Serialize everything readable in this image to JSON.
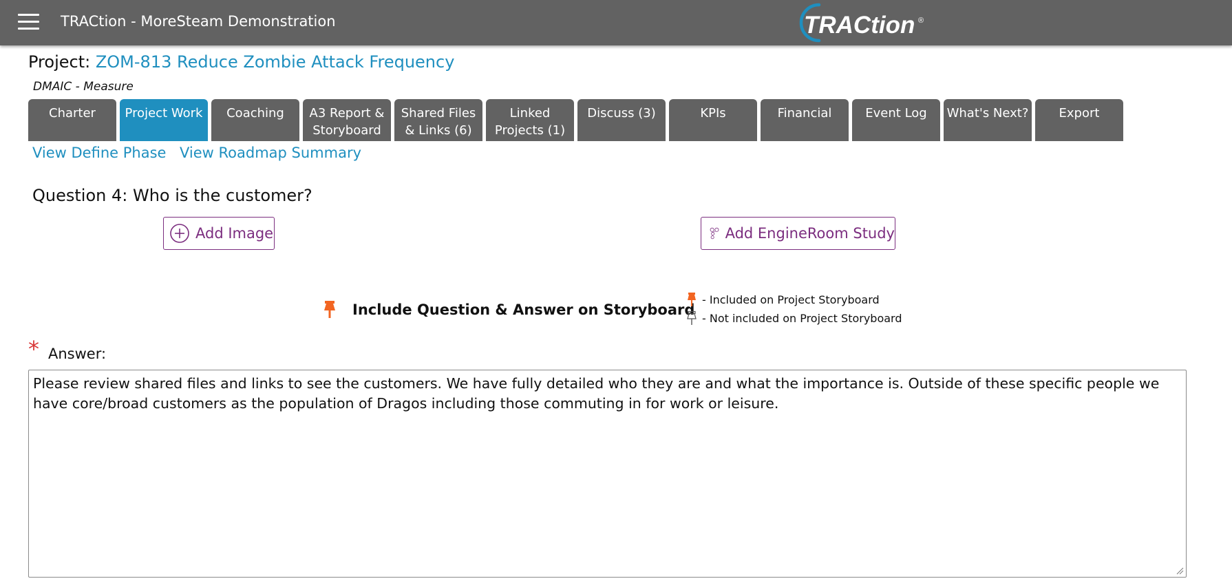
{
  "header": {
    "app_title": "TRACtion - MoreSteam Demonstration",
    "logo_text": "TRACtion",
    "logo_mark": "®"
  },
  "project": {
    "label": "Project:",
    "name": "ZOM-813 Reduce Zombie Attack Frequency",
    "phase": "DMAIC - Measure"
  },
  "tabs": [
    {
      "line1": "Charter",
      "line2": ""
    },
    {
      "line1": "Project Work",
      "line2": ""
    },
    {
      "line1": "Coaching",
      "line2": ""
    },
    {
      "line1": "A3 Report &",
      "line2": "Storyboard"
    },
    {
      "line1": "Shared Files",
      "line2": "& Links (6)"
    },
    {
      "line1": "Linked",
      "line2": "Projects (1)"
    },
    {
      "line1": "Discuss (3)",
      "line2": ""
    },
    {
      "line1": "KPIs",
      "line2": ""
    },
    {
      "line1": "Financial",
      "line2": ""
    },
    {
      "line1": "Event Log",
      "line2": ""
    },
    {
      "line1": "What's Next?",
      "line2": ""
    },
    {
      "line1": "Export",
      "line2": ""
    }
  ],
  "active_tab": "Project Work",
  "sublinks": {
    "define": "View Define Phase",
    "roadmap": "View Roadmap Summary"
  },
  "question": "Question 4: Who is the customer?",
  "buttons": {
    "add_image": "Add Image",
    "add_engineroom": "Add EngineRoom Study"
  },
  "storyboard": {
    "include_label": "Include Question & Answer on Storyboard",
    "legend_included": "- Included on Project Storyboard",
    "legend_not_included": "- Not included on Project Storyboard"
  },
  "answer": {
    "required_mark": "*",
    "label": "Answer:",
    "text": "Please review shared files and links to see the customers. We have fully detailed who they are and what the importance is. Outside of these specific people we have core/broad customers as the population of Dragos including those commuting in for work or leisure."
  },
  "colors": {
    "header_bg": "#626262",
    "link_blue": "#1f8fbf",
    "button_purple": "#7b2d7f",
    "pin_orange": "#f26522",
    "required_red": "#d93838"
  },
  "icons": {
    "menu": "hamburger-icon",
    "add_image": "plus-circle-icon",
    "add_engineroom": "engineroom-icon",
    "pin_filled": "pin-filled-icon",
    "pin_outline": "pin-outline-icon"
  }
}
